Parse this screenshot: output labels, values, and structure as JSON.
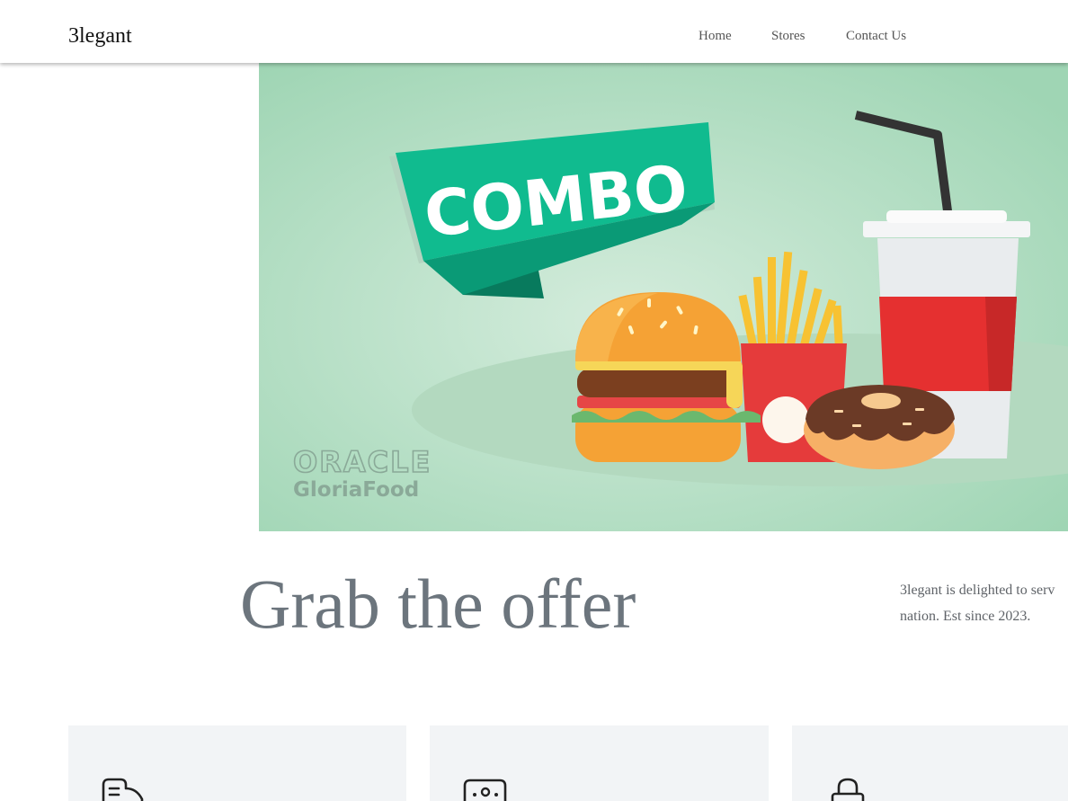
{
  "navbar": {
    "brand": "3legant",
    "links": [
      "Home",
      "Stores",
      "Contact Us"
    ]
  },
  "hero": {
    "banner_text": "COMBO",
    "logo_line1": "ORACLE",
    "logo_line2": "GloriaFood"
  },
  "offer": {
    "headline": "Grab the offer",
    "description_line1": "3legant is delighted to serv",
    "description_line2": "nation. Est since 2023."
  },
  "features": {
    "cards": [
      {
        "icon": "receipt-icon"
      },
      {
        "icon": "store-icon"
      },
      {
        "icon": "lock-icon"
      }
    ]
  },
  "colors": {
    "hero_bg": "#a8dbbd",
    "banner": "#0fb98f",
    "heading_text": "#6c757d",
    "card_bg": "#f2f4f6"
  }
}
